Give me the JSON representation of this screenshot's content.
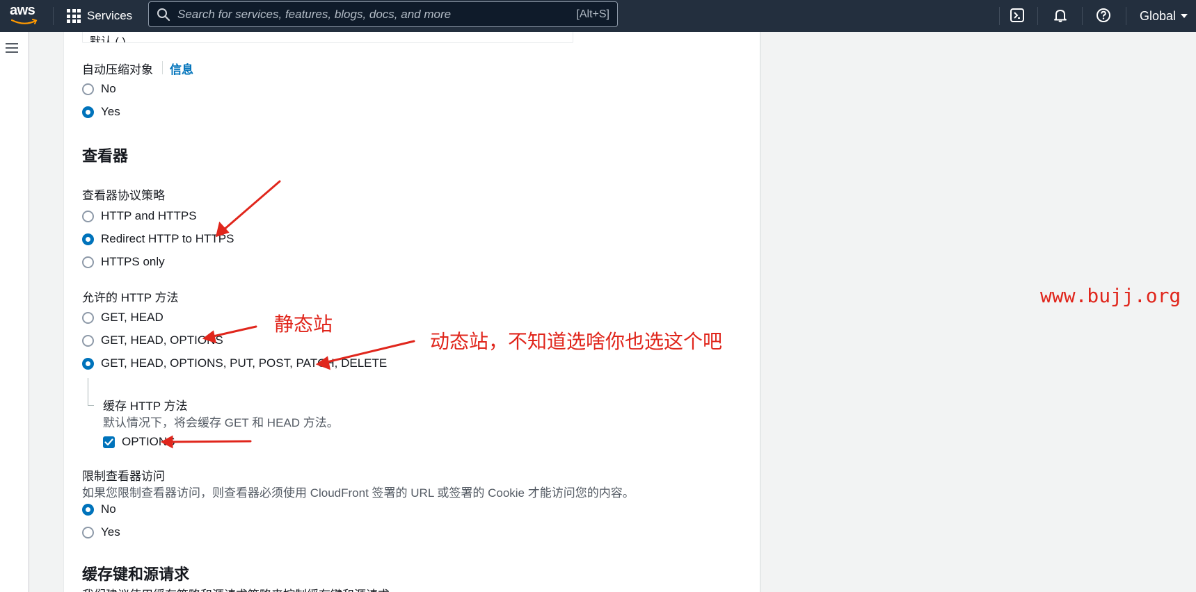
{
  "nav": {
    "logo": "aws",
    "services_label": "Services",
    "search_placeholder": "Search for services, features, blogs, docs, and more",
    "search_shortcut": "[Alt+S]",
    "icons": [
      "cloudshell-icon",
      "bell-icon",
      "help-icon"
    ],
    "region": "Global"
  },
  "form": {
    "truncated_value": "默认 ( )",
    "compress": {
      "label": "自动压缩对象",
      "info": "信息",
      "options": [
        "No",
        "Yes"
      ],
      "selected": "Yes"
    },
    "viewer": {
      "heading": "查看器",
      "protocol": {
        "label": "查看器协议策略",
        "options": [
          "HTTP and HTTPS",
          "Redirect HTTP to HTTPS",
          "HTTPS only"
        ],
        "selected": "Redirect HTTP to HTTPS"
      },
      "methods": {
        "label": "允许的 HTTP 方法",
        "options": [
          "GET, HEAD",
          "GET, HEAD, OPTIONS",
          "GET, HEAD, OPTIONS, PUT, POST, PATCH, DELETE"
        ],
        "selected": "GET, HEAD, OPTIONS, PUT, POST, PATCH, DELETE"
      },
      "cache_methods": {
        "label": "缓存 HTTP 方法",
        "description": "默认情况下，将会缓存 GET 和 HEAD 方法。",
        "option": "OPTIONS",
        "checked": true
      },
      "restrict": {
        "label": "限制查看器访问",
        "description": "如果您限制查看器访问，则查看器必须使用 CloudFront 签署的 URL 或签署的 Cookie 才能访问您的内容。",
        "options": [
          "No",
          "Yes"
        ],
        "selected": "No"
      }
    },
    "cache_key": {
      "heading": "缓存键和源请求",
      "description": "我们建议使用缓存策略和源请求策略来控制缓存键和源请求。"
    }
  },
  "annotations": {
    "static_site": "静态站",
    "dynamic_site": "动态站，不知道选啥你也选这个吧",
    "watermark": "www.bujj.org",
    "color": "#e0261c"
  },
  "colors": {
    "nav_bg": "#232f3e",
    "accent": "#0073bb",
    "annotation": "#e0261c"
  }
}
